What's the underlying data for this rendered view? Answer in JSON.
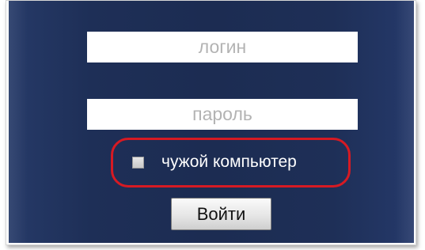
{
  "login_form": {
    "login_placeholder": "логин",
    "password_placeholder": "пароль",
    "remember_label": "чужой компьютер",
    "remember_checked": false,
    "submit_label": "Войти"
  },
  "colors": {
    "panel_background": "#1e2f57",
    "highlight_outline": "#d61a23",
    "label_text": "#ffffff",
    "placeholder_text": "#b3b3b3"
  }
}
